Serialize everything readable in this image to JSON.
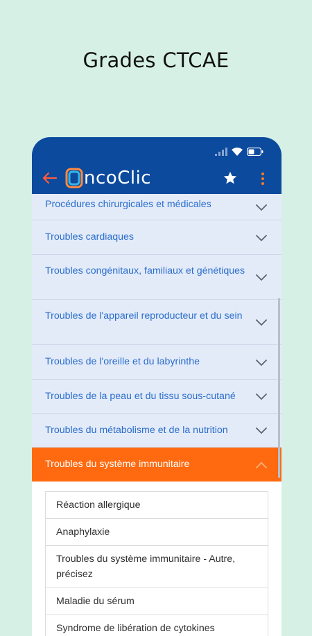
{
  "headline": "Grades CTCAE",
  "app": {
    "logo_first_letter": "O",
    "logo_mid": "nco",
    "logo_c": "C",
    "logo_end": "lic"
  },
  "categories": [
    {
      "label": "Procédures chirurgicales et médicales"
    },
    {
      "label": "Troubles cardiaques"
    },
    {
      "label": "Troubles congénitaux, familiaux et génétiques"
    },
    {
      "label": "Troubles de l'appareil reproducteur et du sein"
    },
    {
      "label": "Troubles de l'oreille et du labyrinthe"
    },
    {
      "label": "Troubles de la peau et du tissu sous-cutané"
    },
    {
      "label": "Troubles du métabolisme et de la nutrition"
    },
    {
      "label": "Troubles du système immunitaire"
    }
  ],
  "subitems": [
    {
      "label": "Réaction allergique"
    },
    {
      "label": "Anaphylaxie"
    },
    {
      "label": "Troubles du système immunitaire - Autre, précisez"
    },
    {
      "label": "Maladie du sérum"
    },
    {
      "label": "Syndrome de libération de cytokines"
    }
  ],
  "colors": {
    "background": "#d6f0e6",
    "appbar": "#0c4a9e",
    "accent": "#ff6a10",
    "row_bg": "#e3ebf9",
    "link": "#2a6dcc"
  },
  "icons": [
    "back-arrow-icon",
    "star-icon",
    "more-vert-icon",
    "chevron-down-icon",
    "chevron-up-icon",
    "signal-icon",
    "wifi-icon",
    "battery-icon"
  ]
}
